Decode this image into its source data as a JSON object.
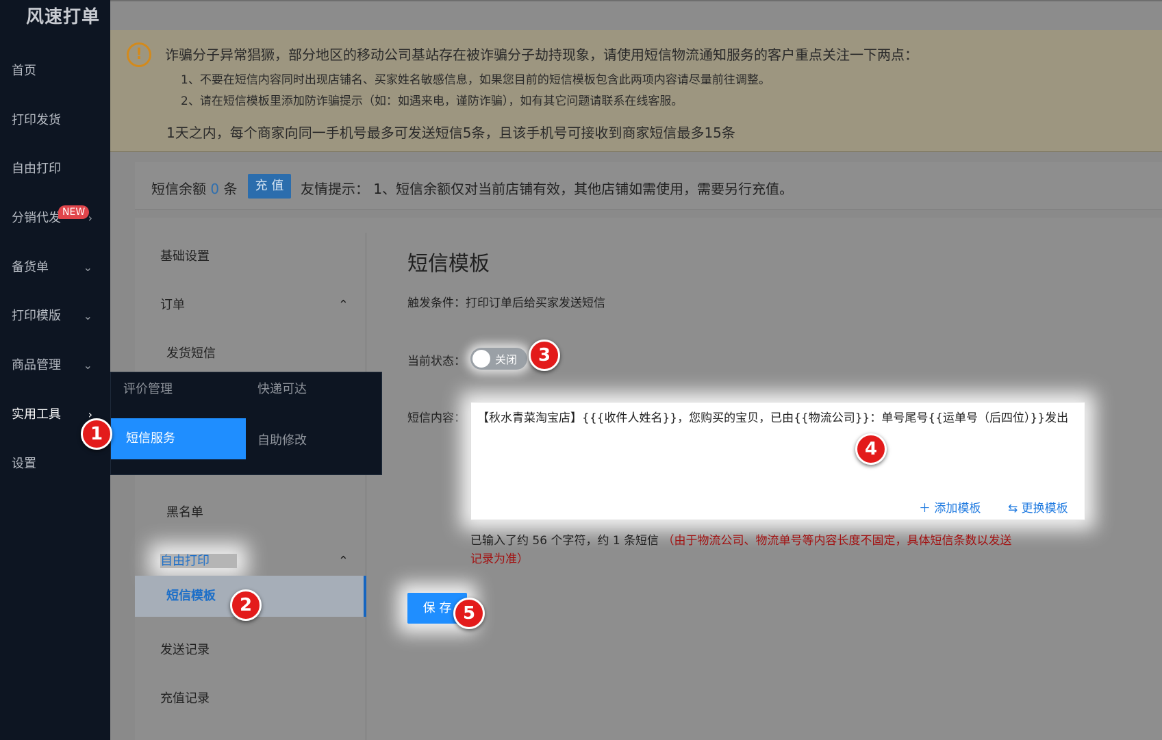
{
  "app": {
    "title": "风速打单"
  },
  "sidebar": {
    "items": [
      {
        "label": "首页"
      },
      {
        "label": "打印发货"
      },
      {
        "label": "自由打印"
      },
      {
        "label": "分销代发",
        "badge": "NEW"
      },
      {
        "label": "备货单"
      },
      {
        "label": "打印模版"
      },
      {
        "label": "商品管理"
      },
      {
        "label": "实用工具"
      },
      {
        "label": "设置"
      }
    ]
  },
  "alert": {
    "title": "诈骗分子异常猖獗，部分地区的移动公司基站存在被诈骗分子劫持现象，请使用短信物流通知服务的客户重点关注一下两点：",
    "line1": "1、不要在短信内容同时出现店铺名、买家姓名敏感信息，如果您目前的短信模板包含此两项内容请尽量前往调整。",
    "line2": "2、请在短信模板里添加防诈骗提示（如：如遇来电，谨防诈骗），如有其它问题请联系在线客服。",
    "limit": "1天之内，每个商家向同一手机号最多可发送短信5条，且该手机号可接收到商家短信最多15条"
  },
  "balance": {
    "prefix": "短信余额",
    "count": "0",
    "unit": "条",
    "recharge_label": "充 值",
    "tip": "友情提示：  1、短信余额仅对当前店铺有效，其他店铺如需使用，需要另行充值。"
  },
  "submenu": {
    "basic": "基础设置",
    "order": "订单",
    "ship_sms": "发货短信",
    "blacklist": "黑名单",
    "free_print": "自由打印",
    "sms_template": "短信模板",
    "send_records": "发送记录",
    "recharge_records": "充值记录"
  },
  "flyout": {
    "review": "评价管理",
    "express": "快递可达",
    "sms_service": "短信服务",
    "self_edit": "自助修改"
  },
  "form": {
    "title": "短信模板",
    "trigger": "触发条件：打印订单后给买家发送短信",
    "status_label": "当前状态：",
    "toggle_label": "关闭",
    "content_label": "短信内容：",
    "content": "【秋水青菜淘宝店】{{{收件人姓名}}，您购买的宝贝，已由{{物流公司}}：单号尾号{{运单号（后四位）}}发出",
    "add_template": "＋  添加模板",
    "change_template": "⇆  更换模板",
    "count_text": "已输入了约 56 个字符，约 1 条短信",
    "warning_part1": "（由于物流公司、物流单号等内容长度不固定，具体短信条数以发送",
    "warning_part2": "记录为准）",
    "save_label": "保 存"
  },
  "steps": [
    "1",
    "2",
    "3",
    "4",
    "5"
  ],
  "colors": {
    "primary": "#1f8eff",
    "sidebar": "#0d1522",
    "marker": "#e31b1b",
    "warning": "#a21212"
  }
}
